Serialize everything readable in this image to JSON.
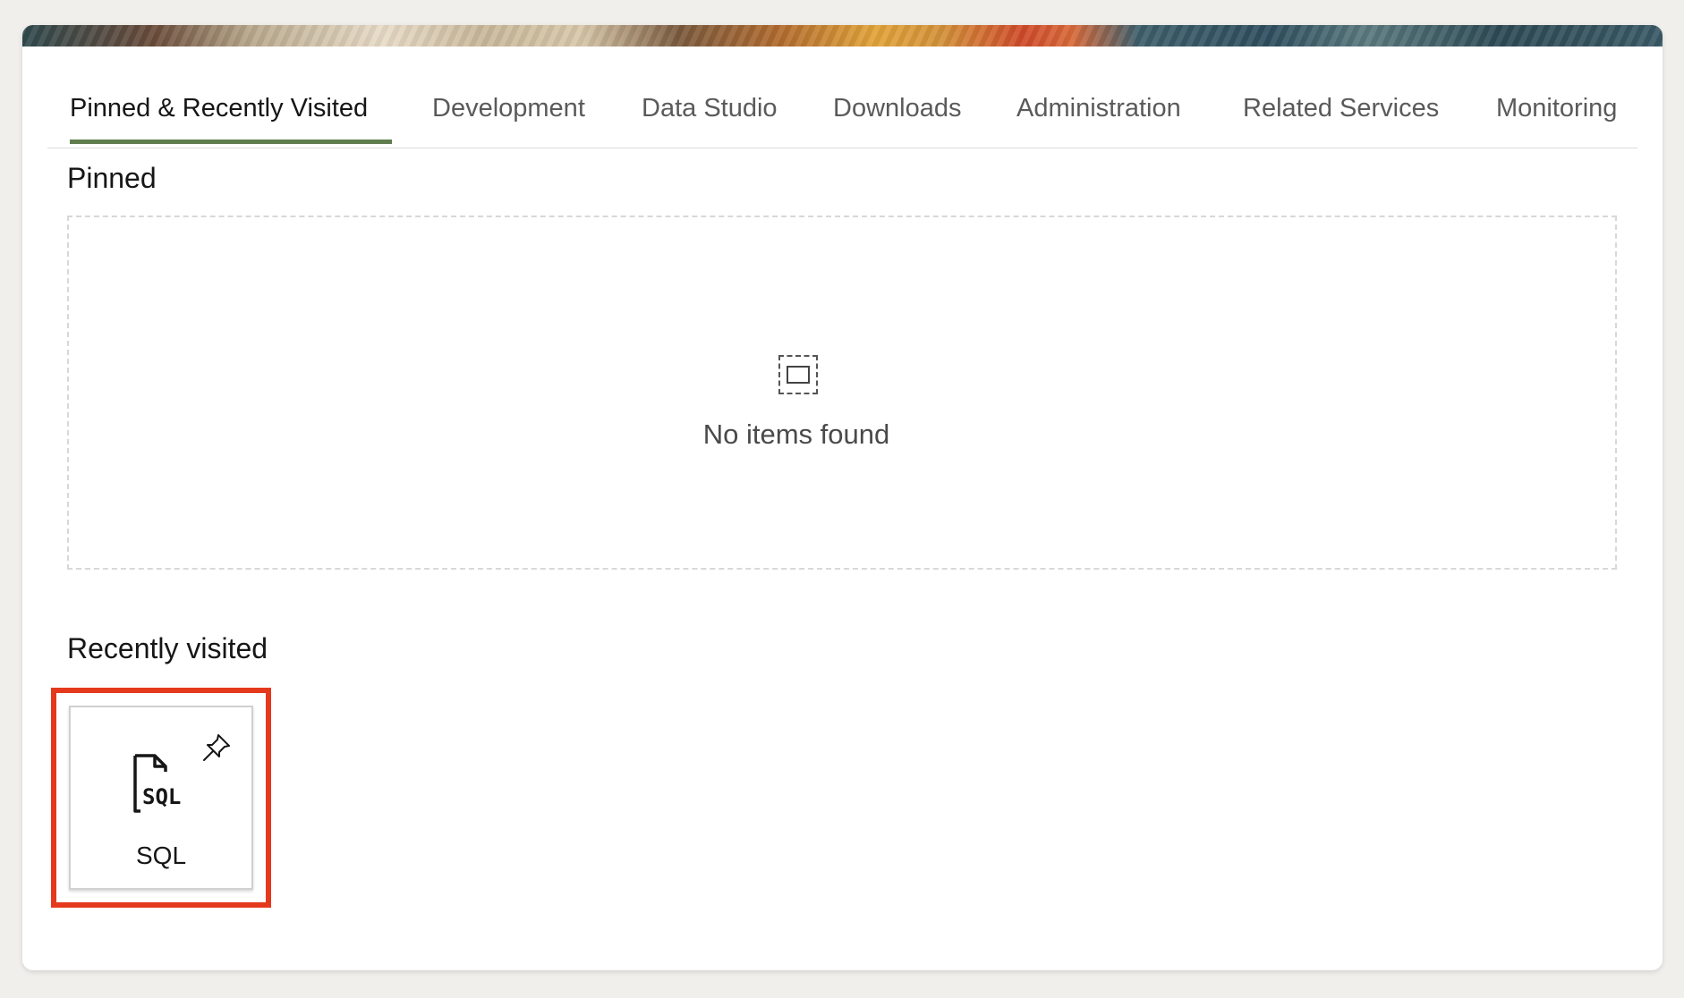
{
  "tabs": [
    {
      "label": "Pinned & Recently Visited",
      "active": true
    },
    {
      "label": "Development"
    },
    {
      "label": "Data Studio"
    },
    {
      "label": "Downloads"
    },
    {
      "label": "Administration"
    },
    {
      "label": "Related Services"
    },
    {
      "label": "Monitoring"
    }
  ],
  "pinned": {
    "title": "Pinned",
    "empty_icon": "empty-placeholder-icon",
    "empty_text": "No items found"
  },
  "recent": {
    "title": "Recently visited",
    "items": [
      {
        "label": "SQL",
        "icon": "sql-file-icon",
        "pin_icon": "pin-icon"
      }
    ]
  },
  "colors": {
    "active_tab_underline": "#5f7d4f",
    "highlight_border": "#e5391d",
    "background": "#f1efec"
  }
}
